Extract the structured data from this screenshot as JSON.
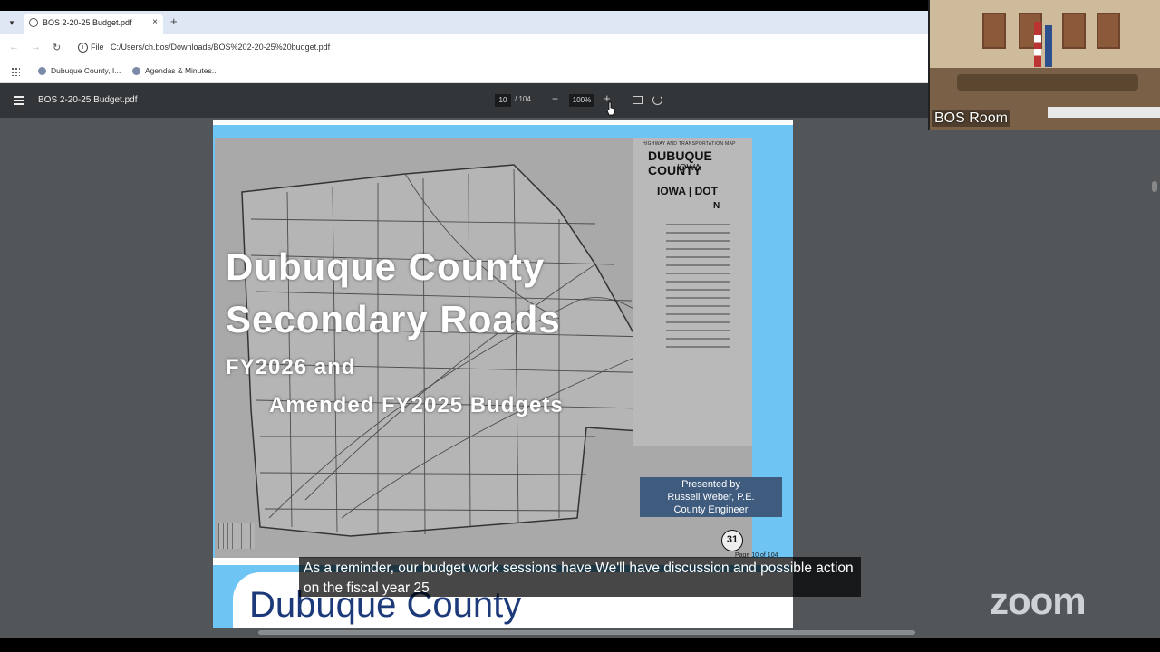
{
  "browser": {
    "tab_title": "BOS 2-20-25 Budget.pdf",
    "tab_close": "×",
    "new_tab": "+",
    "omnibox_scheme": "File",
    "omnibox_url": "C:/Users/ch.bos/Downloads/BOS%202-20-25%20budget.pdf",
    "bookmarks": [
      "Dubuque County, I...",
      "Agendas & Minutes..."
    ]
  },
  "pdf_toolbar": {
    "file_name": "BOS 2-20-25 Budget.pdf",
    "current_page": "10",
    "page_total": "/ 104",
    "zoom_minus": "−",
    "zoom_level": "100%",
    "zoom_plus": "+"
  },
  "slide": {
    "map_header": "HIGHWAY AND TRANSPORTATION MAP",
    "map_county": "DUBUQUE COUNTY",
    "map_state": "IOWA",
    "map_dot": "IOWA | DOT",
    "map_north": "N",
    "title_line1": "Dubuque County",
    "title_line2": "Secondary Roads",
    "subtitle_line1": "FY2026 and",
    "subtitle_line2": "Amended FY2025 Budgets",
    "presented_line1": "Presented by",
    "presented_line2": "Russell Weber, P.E.",
    "presented_line3": "County Engineer",
    "page_badge": "31",
    "page_footer": "Page 10 of 104"
  },
  "next_slide": {
    "title": "Dubuque County"
  },
  "caption": {
    "text": "As a reminder, our budget work sessions have We'll have discussion and possible action on the fiscal year 25"
  },
  "video": {
    "label": "BOS Room"
  },
  "zoom_logo": "zoom",
  "colors": {
    "slide_bg": "#6ec4f3",
    "pdf_bg": "#525659",
    "toolbar_bg": "#323639",
    "presented_bg": "#3f5b7e"
  }
}
